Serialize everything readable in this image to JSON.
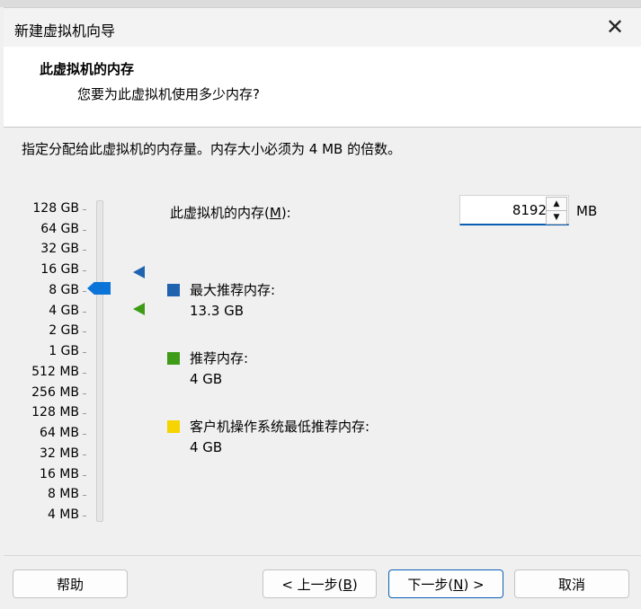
{
  "window": {
    "title": "新建虚拟机向导"
  },
  "header": {
    "title": "此虚拟机的内存",
    "subtitle": "您要为此虚拟机使用多少内存?"
  },
  "instruction": "指定分配给此虚拟机的内存量。内存大小必须为 4 MB 的倍数。",
  "scale": {
    "ticks": [
      "128 GB",
      "64 GB",
      "32 GB",
      "16 GB",
      "8 GB",
      "4 GB",
      "2 GB",
      "1 GB",
      "512 MB",
      "256 MB",
      "128 MB",
      "64 MB",
      "32 MB",
      "16 MB",
      "8 MB",
      "4 MB"
    ],
    "selected": "8 GB"
  },
  "memory": {
    "label_prefix": "此虚拟机的内存(",
    "label_key": "M",
    "label_suffix": "):",
    "value": "8192",
    "unit": "MB"
  },
  "legend": [
    {
      "color": "#1f63b0",
      "label": "最大推荐内存:",
      "value": "13.3 GB"
    },
    {
      "color": "#3e9b18",
      "label": "推荐内存:",
      "value": "4 GB"
    },
    {
      "color": "#f5d400",
      "label": "客户机操作系统最低推荐内存:",
      "value": "4 GB"
    }
  ],
  "buttons": {
    "help": "帮助",
    "back_prefix": "< 上一步(",
    "back_key": "B",
    "back_suffix": ")",
    "next_prefix": "下一步(",
    "next_key": "N",
    "next_suffix": ") >",
    "cancel": "取消"
  },
  "icons": {
    "close": "close-icon",
    "spin_up": "up-arrow-icon",
    "spin_down": "down-arrow-icon"
  },
  "colors": {
    "accent": "#0a74d8",
    "max_recommended": "#1f63b0",
    "recommended": "#3e9b18",
    "guest_min": "#f5d400"
  }
}
